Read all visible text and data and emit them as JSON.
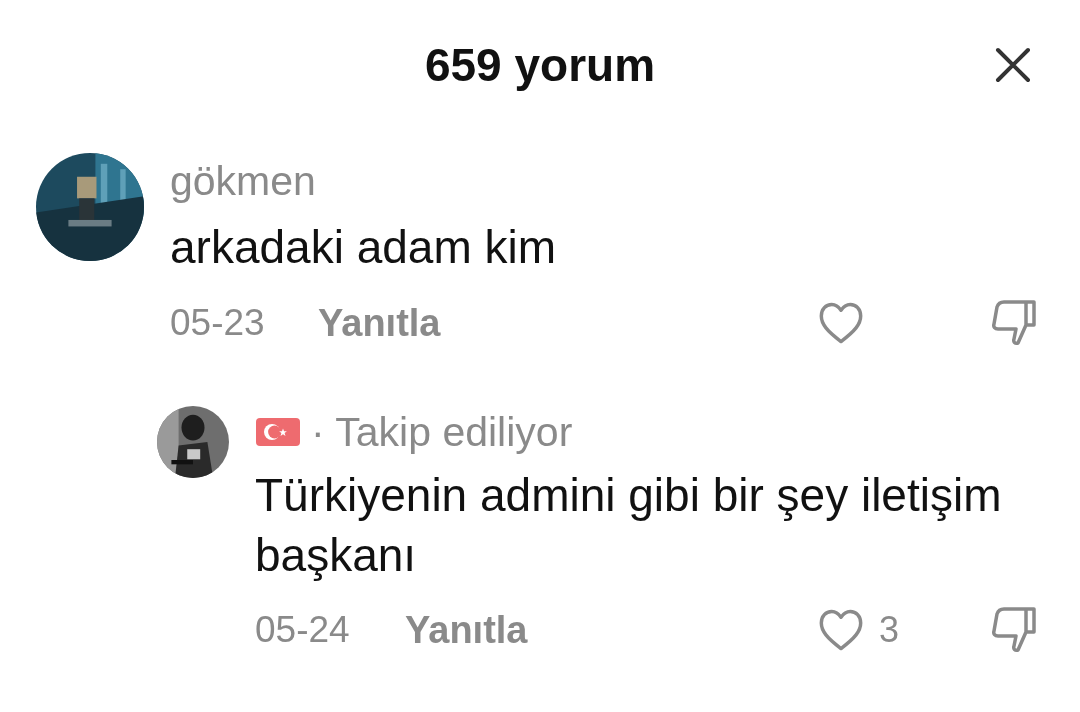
{
  "title": "659 yorum",
  "comments": [
    {
      "username": "gökmen",
      "text": "arkadaki adam kim",
      "date": "05-23",
      "reply_label": "Yanıtla",
      "liked": false,
      "children": [
        {
          "flag": true,
          "badge": "· Takip ediliyor",
          "text": "Türkiyenin admini gibi bir şey iletişim başkanı",
          "date": "05-24",
          "reply_label": "Yanıtla",
          "liked": false,
          "like_count": "3"
        }
      ]
    }
  ]
}
